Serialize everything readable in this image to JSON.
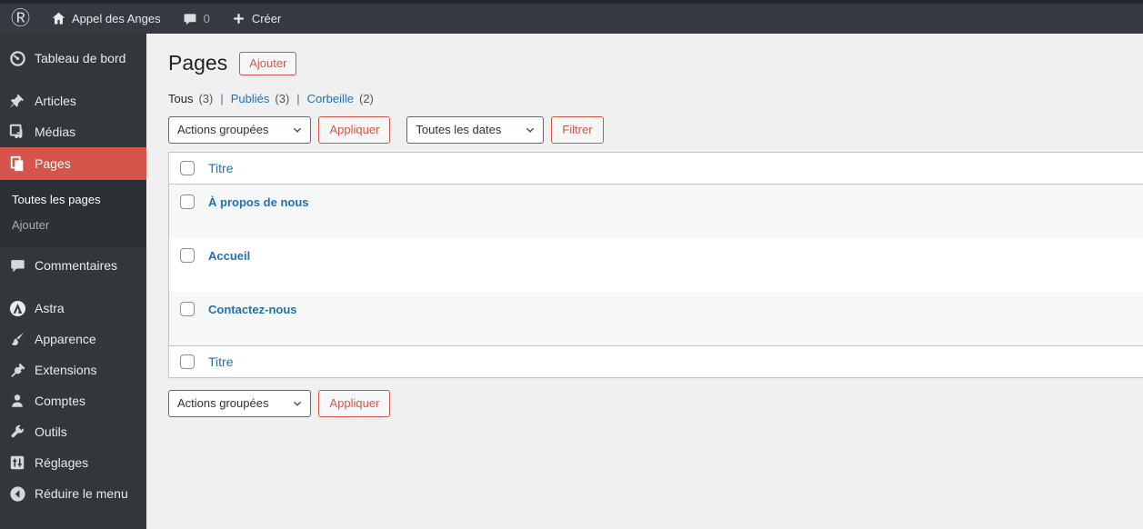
{
  "colors": {
    "accent": "#d6544a",
    "link": "#2271b1",
    "sidebar_bg": "#32373c",
    "topbar_bg": "#343a40"
  },
  "admin_bar": {
    "site_name": "Appel des Anges",
    "comment_count": "0",
    "new_label": "Créer"
  },
  "sidebar": {
    "items": [
      {
        "label": "Tableau de bord"
      },
      {
        "label": "Articles"
      },
      {
        "label": "Médias"
      },
      {
        "label": "Pages",
        "active": true
      },
      {
        "label": "Commentaires"
      },
      {
        "label": "Astra"
      },
      {
        "label": "Apparence"
      },
      {
        "label": "Extensions"
      },
      {
        "label": "Comptes"
      },
      {
        "label": "Outils"
      },
      {
        "label": "Réglages"
      },
      {
        "label": "Réduire le menu"
      }
    ],
    "pages_submenu": [
      {
        "label": "Toutes les pages",
        "current": true
      },
      {
        "label": "Ajouter"
      }
    ]
  },
  "page": {
    "title": "Pages",
    "add_button": "Ajouter",
    "filters_separator": "|",
    "filters": [
      {
        "label": "Tous",
        "count": "(3)",
        "current": true
      },
      {
        "label": "Publiés",
        "count": "(3)"
      },
      {
        "label": "Corbeille",
        "count": "(2)"
      }
    ],
    "bulk_select_value": "Actions groupées",
    "apply_button": "Appliquer",
    "dates_select_value": "Toutes les dates",
    "filter_button": "Filtrer",
    "table": {
      "column_title": "Titre",
      "rows": [
        {
          "title": "À propos de nous"
        },
        {
          "title": "Accueil"
        },
        {
          "title": "Contactez-nous"
        }
      ]
    }
  }
}
